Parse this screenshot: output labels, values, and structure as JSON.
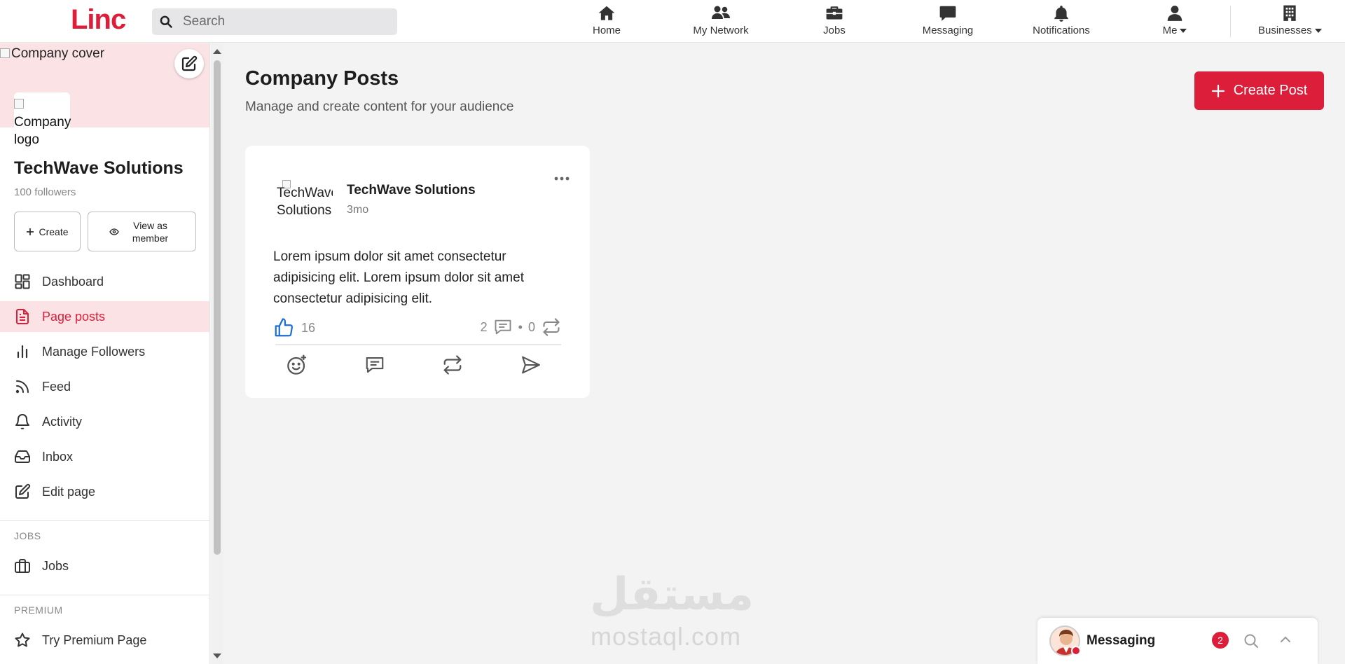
{
  "brand": {
    "logo": "Linc",
    "accent": "#dc1e3b"
  },
  "search": {
    "placeholder": "Search"
  },
  "nav": {
    "items": [
      {
        "label": "Home",
        "icon": "home-icon"
      },
      {
        "label": "My Network",
        "icon": "network-icon"
      },
      {
        "label": "Jobs",
        "icon": "briefcase-icon"
      },
      {
        "label": "Messaging",
        "icon": "message-icon"
      },
      {
        "label": "Notifications",
        "icon": "bell-icon"
      },
      {
        "label": "Me",
        "icon": "user-icon"
      },
      {
        "label": "Businesses",
        "icon": "building-icon"
      }
    ]
  },
  "sidebar": {
    "cover_alt": "Company cover",
    "logo_alt_line1": "Company",
    "logo_alt_line2": "logo",
    "company_name": "TechWave Solutions",
    "followers": "100 followers",
    "create_label": "Create",
    "view_as_member_label": "View as member",
    "items": [
      {
        "label": "Dashboard",
        "icon": "dashboard-icon"
      },
      {
        "label": "Page posts",
        "icon": "document-icon",
        "active": true
      },
      {
        "label": "Manage Followers",
        "icon": "bar-chart-icon"
      },
      {
        "label": "Feed",
        "icon": "rss-icon"
      },
      {
        "label": "Activity",
        "icon": "bell-icon"
      },
      {
        "label": "Inbox",
        "icon": "inbox-icon"
      },
      {
        "label": "Edit page",
        "icon": "edit-icon"
      }
    ],
    "jobs_section": {
      "title": "JOBS",
      "item": "Jobs"
    },
    "premium_section": {
      "title": "PREMIUM",
      "item": "Try Premium Page"
    }
  },
  "main": {
    "title": "Company Posts",
    "subtitle": "Manage and create content for your audience",
    "create_post_label": "Create Post"
  },
  "post": {
    "avatar_alt_line1": "TechWave",
    "avatar_alt_line2": "Solutions",
    "author": "TechWave Solutions",
    "time": "3mo",
    "body": "Lorem ipsum dolor sit amet consectetur adipisicing elit. Lorem ipsum dolor sit amet consectetur adipisicing elit.",
    "likes": "16",
    "comments": "2",
    "separator": "•",
    "reposts": "0"
  },
  "watermark": {
    "arabic": "مستقل",
    "latin": "mostaql.com"
  },
  "messaging": {
    "label": "Messaging",
    "badge": "2"
  }
}
